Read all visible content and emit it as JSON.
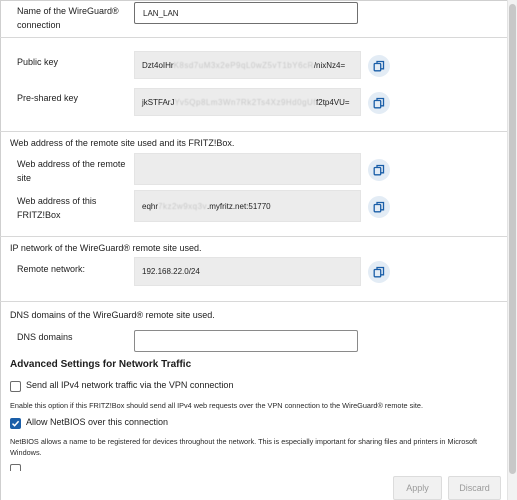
{
  "connection": {
    "name_label": "Name of the WireGuard® connection",
    "name_value": "LAN_LAN"
  },
  "keys": {
    "public_key_label": "Public key",
    "public_key_value_start": "Dzt4oIHr",
    "public_key_value_blur": "K8sd7uM3x2eP9qL0wZ5vT1bY6cR",
    "public_key_value_end": "/nixNz4=",
    "preshared_key_label": "Pre-shared key",
    "preshared_key_value_start": "jkSTFArJ",
    "preshared_key_value_blur": "Yv5Qp8Lm3Wn7Rk2Ts4Xz9Hd0gUf",
    "preshared_key_value_end": "f2tp4VU="
  },
  "web_address": {
    "section_title": "Web address of the remote site used and its FRITZ!Box.",
    "remote_label": "Web address of the remote site",
    "remote_value": "",
    "this_label": "Web address of this FRITZ!Box",
    "this_value_start": "eqhr",
    "this_value_blur": "7kz2w9xq3v",
    ".myfritz.net:51770": "",
    "this_value_end": ".myfritz.net:51770"
  },
  "ip_network": {
    "section_title": "IP network of the WireGuard® remote site used.",
    "remote_network_label": "Remote network:",
    "remote_network_value": "192.168.22.0/24"
  },
  "dns": {
    "section_title": "DNS domains of the WireGuard® remote site used.",
    "dns_label": "DNS domains",
    "dns_value": ""
  },
  "advanced": {
    "title": "Advanced Settings for Network Traffic",
    "opt_ipv4_label": "Send all IPv4 network traffic via the VPN connection",
    "opt_ipv4_checked": false,
    "opt_ipv4_desc": "Enable this option if this FRITZ!Box should send all IPv4 web requests over the VPN connection to the WireGuard® remote site.",
    "opt_netbios_label": "Allow NetBIOS over this connection",
    "opt_netbios_checked": true,
    "opt_netbios_desc": "NetBIOS allows a name to be registered for devices throughout the network. This is especially important for sharing files and printers in Microsoft Windows."
  },
  "footer": {
    "apply_label": "Apply",
    "discard_label": "Discard"
  },
  "colors": {
    "accent": "#1a5ea8",
    "copy_bg": "#e3ecf5",
    "field_bg": "#ececec"
  },
  "icons": {
    "copy": "copy-icon",
    "check": "check-icon"
  }
}
